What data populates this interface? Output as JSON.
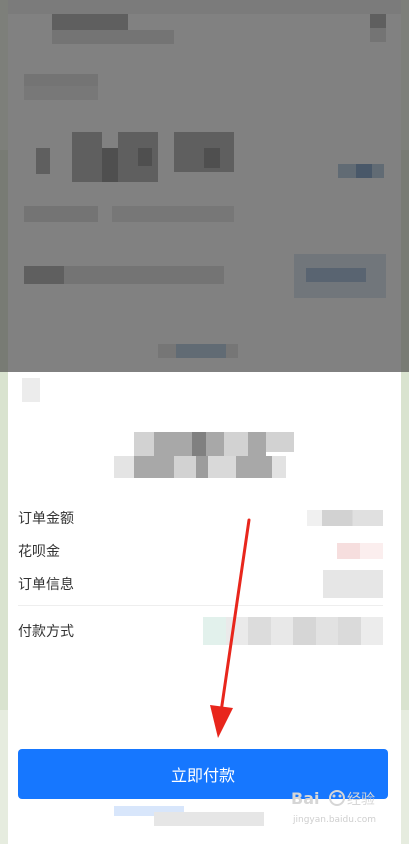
{
  "sheet": {
    "rows": [
      {
        "label": "订单金额"
      },
      {
        "label": "花呗金"
      },
      {
        "label": "订单信息"
      },
      {
        "label": "付款方式"
      }
    ],
    "pay_button_label": "立即付款"
  },
  "colors": {
    "primary": "#1677ff",
    "annotation_arrow": "#e8261c"
  },
  "icons": [
    "close-icon"
  ]
}
